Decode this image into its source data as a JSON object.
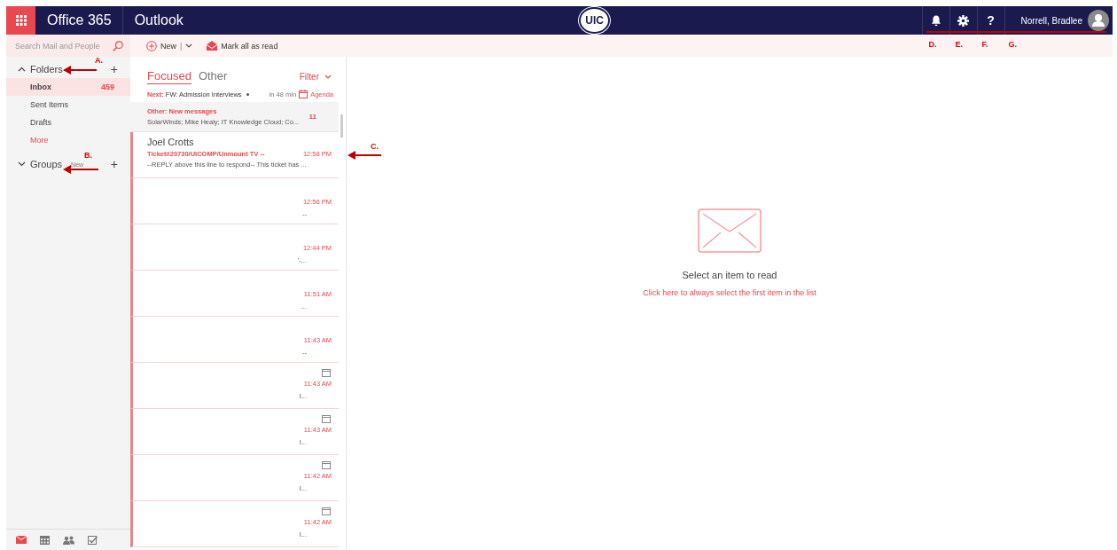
{
  "header": {
    "brand": "Office 365",
    "app": "Outlook",
    "logo": "UIC",
    "user": "Norrell, Bradlee",
    "help": "?"
  },
  "search": {
    "placeholder": "Search Mail and People"
  },
  "toolbar": {
    "new": "New",
    "separator": "|",
    "mark_all": "Mark all as read"
  },
  "folders": {
    "heading": "Folders",
    "add": "+",
    "expanded": true,
    "items": [
      {
        "label": "Inbox",
        "count": "459",
        "selected": true
      },
      {
        "label": "Sent Items",
        "selected": false
      },
      {
        "label": "Drafts",
        "selected": false
      }
    ],
    "more": "More",
    "groups_heading": "Groups",
    "groups_expanded": false,
    "groups_new": "New",
    "groups_add": "+"
  },
  "modules": [
    {
      "kind": "mail",
      "selected": true
    },
    {
      "kind": "calendar",
      "selected": false
    },
    {
      "kind": "people",
      "selected": false
    },
    {
      "kind": "tasks",
      "selected": false
    }
  ],
  "list": {
    "tabs": [
      {
        "label": "Focused",
        "selected": true
      },
      {
        "label": "Other",
        "selected": false
      }
    ],
    "filter": "Filter",
    "next": {
      "label": "Next:",
      "subject": "FW: Admission Interviews",
      "time": "in 48 min",
      "agenda": "Agenda"
    },
    "other_banner": {
      "title": "Other: New messages",
      "senders": "SolarWinds; Mike Healy; IT Knowledge Cloud; Co...",
      "count": "11"
    },
    "messages": [
      {
        "sender": "Joel Crotts",
        "subject": "Ticket#20730/UICOMP/Unmount TV --",
        "time": "12:58 PM",
        "preview": "--REPLY above this line to respond--  This ticket has ...",
        "unread": true,
        "calendar": false
      },
      {
        "time": "12:56 PM",
        "preview": "--",
        "unread": true,
        "calendar": false
      },
      {
        "time": "12:44 PM",
        "preview": "'-...",
        "unread": true,
        "calendar": false
      },
      {
        "time": "11:51 AM",
        "preview": "...",
        "unread": true,
        "calendar": false
      },
      {
        "time": "11:43 AM",
        "preview": "--",
        "unread": true,
        "calendar": false
      },
      {
        "time": "11:43 AM",
        "preview": "I...",
        "unread": true,
        "calendar": true
      },
      {
        "time": "11:43 AM",
        "preview": "I...",
        "unread": true,
        "calendar": true
      },
      {
        "time": "11:42 AM",
        "preview": "I...",
        "unread": true,
        "calendar": true
      },
      {
        "time": "11:42 AM",
        "preview": "I...",
        "unread": true,
        "calendar": true
      }
    ]
  },
  "reading": {
    "heading": "Select an item to read",
    "link": "Click here to always select the first item in the list"
  },
  "annotations": {
    "folders": "A.",
    "groups": "B.",
    "message": "C.",
    "header": [
      "D.",
      "E.",
      "F.",
      "G."
    ]
  }
}
